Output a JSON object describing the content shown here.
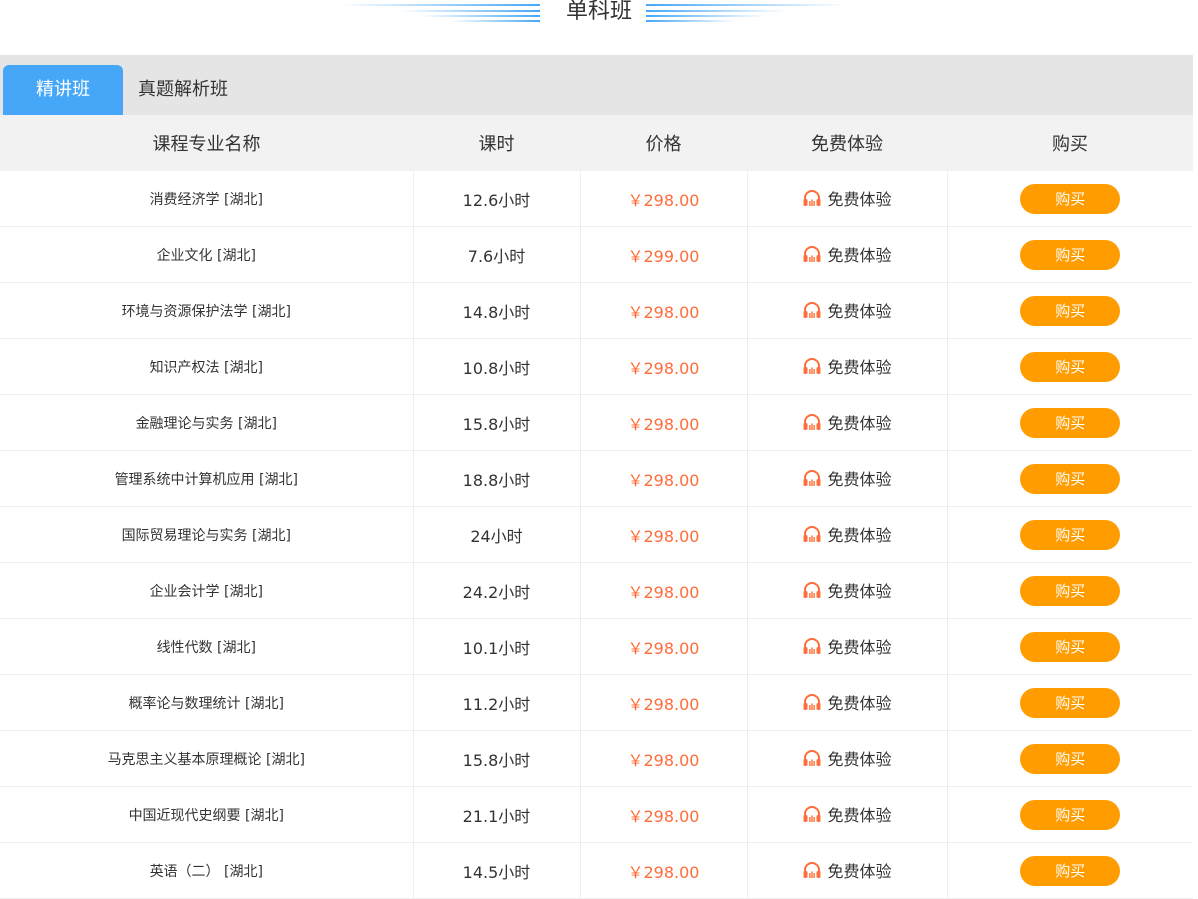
{
  "section": {
    "title": "单科班"
  },
  "tabs": [
    {
      "label": "精讲班",
      "active": true
    },
    {
      "label": "真题解析班",
      "active": false
    }
  ],
  "table": {
    "headers": [
      "课程专业名称",
      "课时",
      "价格",
      "免费体验",
      "购买"
    ],
    "rows": [
      {
        "name": "消费经济学 [湖北]",
        "hours": "12.6小时",
        "price": "￥298.00",
        "trial": "免费体验",
        "buy": "购买"
      },
      {
        "name": "企业文化 [湖北]",
        "hours": "7.6小时",
        "price": "￥299.00",
        "trial": "免费体验",
        "buy": "购买"
      },
      {
        "name": "环境与资源保护法学 [湖北]",
        "hours": "14.8小时",
        "price": "￥298.00",
        "trial": "免费体验",
        "buy": "购买"
      },
      {
        "name": "知识产权法 [湖北]",
        "hours": "10.8小时",
        "price": "￥298.00",
        "trial": "免费体验",
        "buy": "购买"
      },
      {
        "name": "金融理论与实务 [湖北]",
        "hours": "15.8小时",
        "price": "￥298.00",
        "trial": "免费体验",
        "buy": "购买"
      },
      {
        "name": "管理系统中计算机应用 [湖北]",
        "hours": "18.8小时",
        "price": "￥298.00",
        "trial": "免费体验",
        "buy": "购买"
      },
      {
        "name": "国际贸易理论与实务 [湖北]",
        "hours": "24小时",
        "price": "￥298.00",
        "trial": "免费体验",
        "buy": "购买"
      },
      {
        "name": "企业会计学 [湖北]",
        "hours": "24.2小时",
        "price": "￥298.00",
        "trial": "免费体验",
        "buy": "购买"
      },
      {
        "name": "线性代数 [湖北]",
        "hours": "10.1小时",
        "price": "￥298.00",
        "trial": "免费体验",
        "buy": "购买"
      },
      {
        "name": "概率论与数理统计 [湖北]",
        "hours": "11.2小时",
        "price": "￥298.00",
        "trial": "免费体验",
        "buy": "购买"
      },
      {
        "name": "马克思主义基本原理概论 [湖北]",
        "hours": "15.8小时",
        "price": "￥298.00",
        "trial": "免费体验",
        "buy": "购买"
      },
      {
        "name": "中国近现代史纲要 [湖北]",
        "hours": "21.1小时",
        "price": "￥298.00",
        "trial": "免费体验",
        "buy": "购买"
      },
      {
        "name": "英语（二） [湖北]",
        "hours": "14.5小时",
        "price": "￥298.00",
        "trial": "免费体验",
        "buy": "购买"
      }
    ]
  },
  "colors": {
    "tab_active": "#46a7f8",
    "price": "#ff6d3b",
    "buy_button": "#ff9c00",
    "headphone_icon": "#ff6d3b"
  },
  "icons": {
    "trial": "headphone-icon",
    "decoration": "line-decoration"
  }
}
